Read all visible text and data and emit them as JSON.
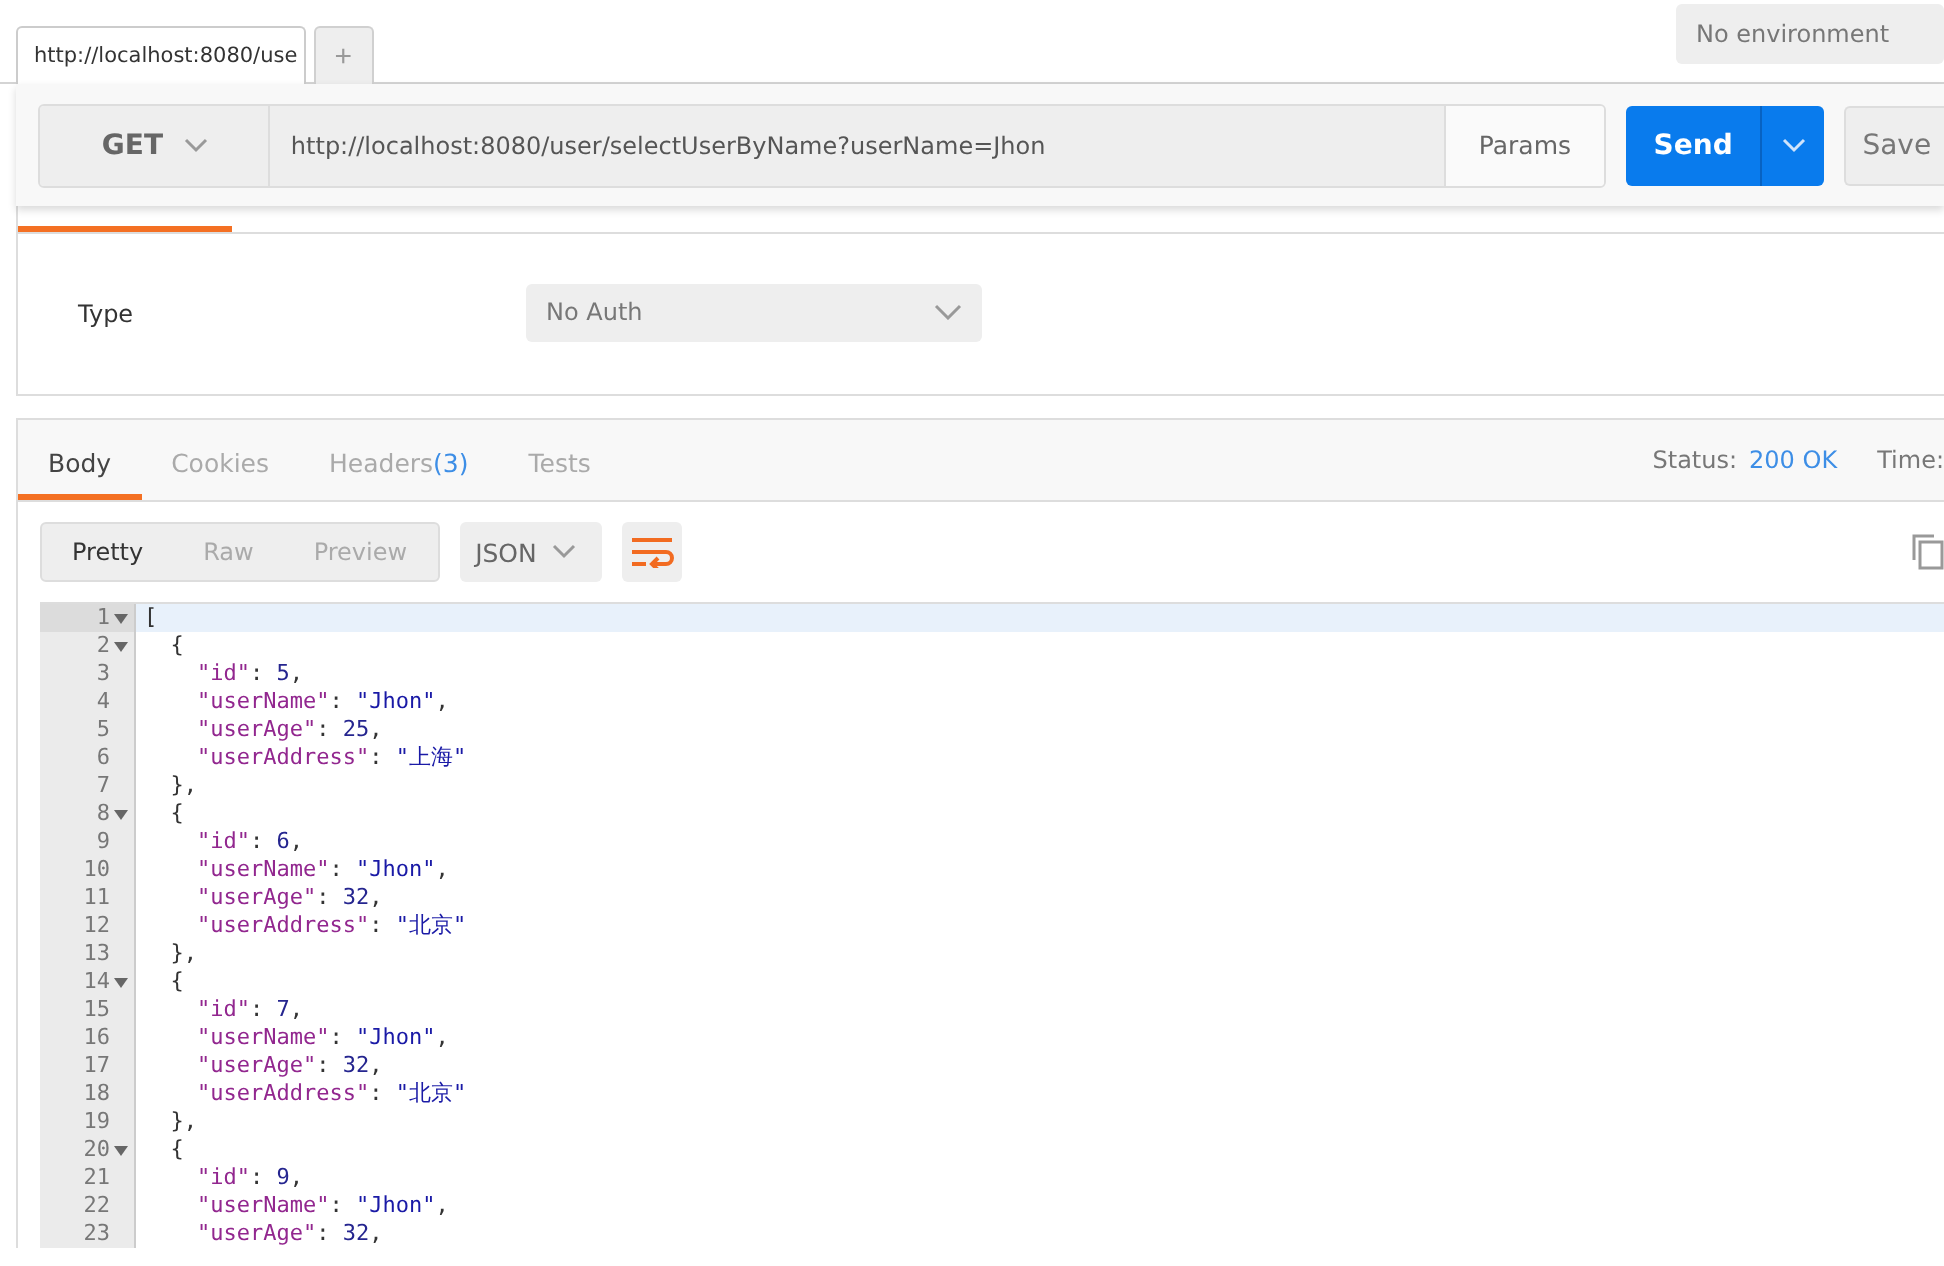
{
  "tabs": [
    {
      "label": "http://localhost:8080/use",
      "selected": true
    }
  ],
  "new_tab": {
    "label": "+"
  },
  "environment": {
    "value": "No environment"
  },
  "request": {
    "method": "GET",
    "url": "http://localhost:8080/user/selectUserByName?userName=Jhon",
    "params": "Params",
    "send": "Send",
    "save": "Save"
  },
  "auth": {
    "type_label": "Type",
    "type_value": "No Auth"
  },
  "response": {
    "tabs": [
      {
        "label": "Body",
        "selected": true
      },
      {
        "label": "Cookies",
        "selected": false
      },
      {
        "label": "Headers",
        "count": "(3)",
        "selected": false
      },
      {
        "label": "Tests",
        "selected": false
      }
    ],
    "status_label": "Status:",
    "status_value": "200 OK",
    "time_label": "Time:",
    "views": [
      {
        "label": "Pretty",
        "selected": true
      },
      {
        "label": "Raw",
        "selected": false
      },
      {
        "label": "Preview",
        "selected": false
      }
    ],
    "format": "JSON",
    "lines": [
      {
        "num": "1",
        "fold": true,
        "tokens": [
          {
            "kind": "punct",
            "text": "["
          }
        ]
      },
      {
        "num": "2",
        "fold": true,
        "tokens": [
          {
            "kind": "punct",
            "text": "  {"
          }
        ]
      },
      {
        "num": "3",
        "fold": false,
        "tokens": [
          {
            "kind": "key",
            "text": "    \"id\""
          },
          {
            "kind": "punct",
            "text": ": "
          },
          {
            "kind": "number",
            "text": "5"
          },
          {
            "kind": "punct",
            "text": ","
          }
        ]
      },
      {
        "num": "4",
        "fold": false,
        "tokens": [
          {
            "kind": "key",
            "text": "    \"userName\""
          },
          {
            "kind": "punct",
            "text": ": "
          },
          {
            "kind": "string",
            "text": "\"Jhon\""
          },
          {
            "kind": "punct",
            "text": ","
          }
        ]
      },
      {
        "num": "5",
        "fold": false,
        "tokens": [
          {
            "kind": "key",
            "text": "    \"userAge\""
          },
          {
            "kind": "punct",
            "text": ": "
          },
          {
            "kind": "number",
            "text": "25"
          },
          {
            "kind": "punct",
            "text": ","
          }
        ]
      },
      {
        "num": "6",
        "fold": false,
        "tokens": [
          {
            "kind": "key",
            "text": "    \"userAddress\""
          },
          {
            "kind": "punct",
            "text": ": "
          },
          {
            "kind": "string",
            "text": "\"上海\""
          }
        ]
      },
      {
        "num": "7",
        "fold": false,
        "tokens": [
          {
            "kind": "punct",
            "text": "  },"
          }
        ]
      },
      {
        "num": "8",
        "fold": true,
        "tokens": [
          {
            "kind": "punct",
            "text": "  {"
          }
        ]
      },
      {
        "num": "9",
        "fold": false,
        "tokens": [
          {
            "kind": "key",
            "text": "    \"id\""
          },
          {
            "kind": "punct",
            "text": ": "
          },
          {
            "kind": "number",
            "text": "6"
          },
          {
            "kind": "punct",
            "text": ","
          }
        ]
      },
      {
        "num": "10",
        "fold": false,
        "tokens": [
          {
            "kind": "key",
            "text": "    \"userName\""
          },
          {
            "kind": "punct",
            "text": ": "
          },
          {
            "kind": "string",
            "text": "\"Jhon\""
          },
          {
            "kind": "punct",
            "text": ","
          }
        ]
      },
      {
        "num": "11",
        "fold": false,
        "tokens": [
          {
            "kind": "key",
            "text": "    \"userAge\""
          },
          {
            "kind": "punct",
            "text": ": "
          },
          {
            "kind": "number",
            "text": "32"
          },
          {
            "kind": "punct",
            "text": ","
          }
        ]
      },
      {
        "num": "12",
        "fold": false,
        "tokens": [
          {
            "kind": "key",
            "text": "    \"userAddress\""
          },
          {
            "kind": "punct",
            "text": ": "
          },
          {
            "kind": "string",
            "text": "\"北京\""
          }
        ]
      },
      {
        "num": "13",
        "fold": false,
        "tokens": [
          {
            "kind": "punct",
            "text": "  },"
          }
        ]
      },
      {
        "num": "14",
        "fold": true,
        "tokens": [
          {
            "kind": "punct",
            "text": "  {"
          }
        ]
      },
      {
        "num": "15",
        "fold": false,
        "tokens": [
          {
            "kind": "key",
            "text": "    \"id\""
          },
          {
            "kind": "punct",
            "text": ": "
          },
          {
            "kind": "number",
            "text": "7"
          },
          {
            "kind": "punct",
            "text": ","
          }
        ]
      },
      {
        "num": "16",
        "fold": false,
        "tokens": [
          {
            "kind": "key",
            "text": "    \"userName\""
          },
          {
            "kind": "punct",
            "text": ": "
          },
          {
            "kind": "string",
            "text": "\"Jhon\""
          },
          {
            "kind": "punct",
            "text": ","
          }
        ]
      },
      {
        "num": "17",
        "fold": false,
        "tokens": [
          {
            "kind": "key",
            "text": "    \"userAge\""
          },
          {
            "kind": "punct",
            "text": ": "
          },
          {
            "kind": "number",
            "text": "32"
          },
          {
            "kind": "punct",
            "text": ","
          }
        ]
      },
      {
        "num": "18",
        "fold": false,
        "tokens": [
          {
            "kind": "key",
            "text": "    \"userAddress\""
          },
          {
            "kind": "punct",
            "text": ": "
          },
          {
            "kind": "string",
            "text": "\"北京\""
          }
        ]
      },
      {
        "num": "19",
        "fold": false,
        "tokens": [
          {
            "kind": "punct",
            "text": "  },"
          }
        ]
      },
      {
        "num": "20",
        "fold": true,
        "tokens": [
          {
            "kind": "punct",
            "text": "  {"
          }
        ]
      },
      {
        "num": "21",
        "fold": false,
        "tokens": [
          {
            "kind": "key",
            "text": "    \"id\""
          },
          {
            "kind": "punct",
            "text": ": "
          },
          {
            "kind": "number",
            "text": "9"
          },
          {
            "kind": "punct",
            "text": ","
          }
        ]
      },
      {
        "num": "22",
        "fold": false,
        "tokens": [
          {
            "kind": "key",
            "text": "    \"userName\""
          },
          {
            "kind": "punct",
            "text": ": "
          },
          {
            "kind": "string",
            "text": "\"Jhon\""
          },
          {
            "kind": "punct",
            "text": ","
          }
        ]
      },
      {
        "num": "23",
        "fold": false,
        "tokens": [
          {
            "kind": "key",
            "text": "    \"userAge\""
          },
          {
            "kind": "punct",
            "text": ": "
          },
          {
            "kind": "number",
            "text": "32"
          },
          {
            "kind": "punct",
            "text": ","
          }
        ]
      }
    ]
  }
}
